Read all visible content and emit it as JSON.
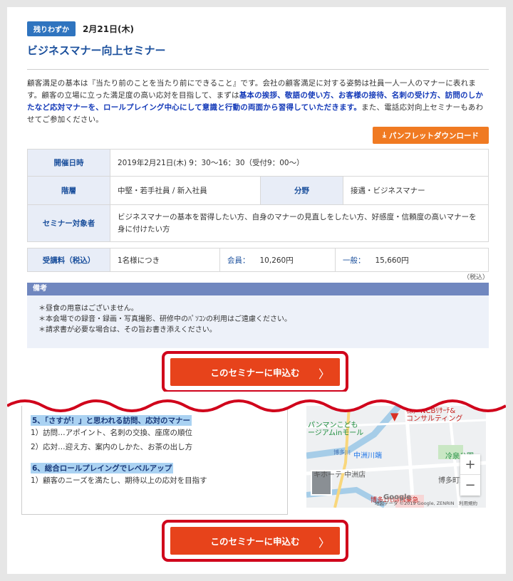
{
  "header": {
    "badge": "残りわずか",
    "date": "2月21日(木)",
    "title": "ビジネスマナー向上セミナー"
  },
  "description": {
    "part1": "顧客満足の基本は『当たり前のことを当たり前にできること』です。会社の顧客満足に対する姿勢は社員一人一人のマナーに表れます。顧客の立場に立った満足度の高い応対を目指して、まずは",
    "highlight": "基本の挨拶、敬語の使い方、お客様の接待、名刺の受け方、訪問のしかたなど応対マナーを、ロールプレイング中心にして意識と行動の両面から習得していただきます。",
    "part2": "また、電話応対向上セミナーもあわせてご参加ください。"
  },
  "download_button": "パンフレットダウンロード",
  "info_table": {
    "date_label": "開催日時",
    "date_value": "2019年2月21日(木) 9：30〜16：30（受付9：00〜）",
    "level_label": "階層",
    "level_value": "中堅・若手社員 / 新入社員",
    "field_label": "分野",
    "field_value": "接遇・ビジネスマナー",
    "target_label": "セミナー対象者",
    "target_value": "ビジネスマナーの基本を習得したい方、自身のマナーの見直しをしたい方、好感度・信頼度の高いマナーを身に付けたい方"
  },
  "fee_table": {
    "label": "受講料（税込）",
    "unit": "1名様につき",
    "member_label": "会員：",
    "member_price": "10,260円",
    "general_label": "一般：",
    "general_price": "15,660円",
    "tax_note": "（税込）"
  },
  "notes": {
    "heading": "備考",
    "items": [
      "＊昼食の用意はございません。",
      "＊本会場での録音・録画・写真撮影、研修中のﾊﾟｿｺﾝの利用はご遠慮ください。",
      "＊請求書が必要な場合は、その旨お書き添えください。"
    ]
  },
  "cta": {
    "label": "このセミナーに申込む",
    "chevron": "〉"
  },
  "course": {
    "sec5": "5、「さすが！」と思われる訪問、応対のマナー",
    "sec5_items": [
      "1）訪問…アポイント、名刺の交換、座席の順位",
      "2）応対…迎え方、案内のしかた、お茶の出し方"
    ],
    "sec6": "6、総合ロールプレイングでレベルアップ",
    "sec6_items": [
      "1）顧客のニーズを満たし、期待以上の応対を目指す"
    ]
  },
  "map": {
    "label_consulting": "株）NCBﾘｻｰﾁ&\nコンサルティング",
    "label_mall": "パンマンこども\nージアムinモール",
    "label_station": "中洲川端",
    "label_park": "冷泉公園",
    "label_hakata": "博多町家",
    "label_hotel": "博多ｴｸｾﾙﾎﾃﾙ東急",
    "label_keyhotel": "キホーテ 中洲店",
    "label_canal": "博多川",
    "google": "Google",
    "footer": "地図データ ©2019 Google, ZENRIN　利用規約",
    "zoom_in": "+",
    "zoom_out": "−"
  },
  "colors": {
    "accent_blue": "#1a4f9c",
    "badge_blue": "#2f74bf",
    "cta_red": "#e7431b",
    "download_orange": "#f07a22",
    "highlight_blue": "#1339b8"
  }
}
